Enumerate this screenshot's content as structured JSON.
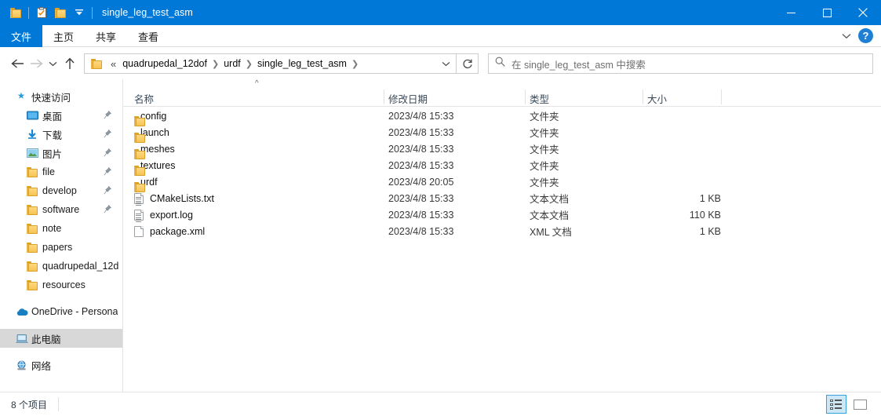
{
  "window": {
    "title": "single_leg_test_asm",
    "accent_color": "#0078d7",
    "quick_access": [
      {
        "name": "folder-icon",
        "label": "保存"
      },
      {
        "name": "properties-icon",
        "label": "属性"
      },
      {
        "name": "new-folder-icon",
        "label": "新建文件夹"
      },
      {
        "name": "customize-qat-icon",
        "label": "自定义快速访问工具栏"
      }
    ],
    "controls": [
      {
        "name": "minimize-button",
        "glyph": "—"
      },
      {
        "name": "maximize-button",
        "glyph": "□"
      },
      {
        "name": "close-button",
        "glyph": "✕"
      }
    ]
  },
  "ribbon": {
    "tabs": [
      {
        "label": "文件",
        "selected": true
      },
      {
        "label": "主页",
        "selected": false
      },
      {
        "label": "共享",
        "selected": false
      },
      {
        "label": "查看",
        "selected": false
      }
    ],
    "expand_label": "展开功能区",
    "help_label": "?"
  },
  "nav": {
    "back_label": "后退",
    "forward_label": "前进",
    "recent_label": "最近浏览的位置",
    "up_label": "上移到",
    "breadcrumb_prefix": "«",
    "breadcrumb": [
      "quadrupedal_12dof",
      "urdf",
      "single_leg_test_asm"
    ],
    "dropdown_label": "先前的位置",
    "refresh_label": "刷新"
  },
  "search": {
    "placeholder": "在 single_leg_test_asm 中搜索",
    "icon": "search-icon"
  },
  "sidebar": {
    "items": [
      {
        "label": "快速访问",
        "icon": "star-pin-icon",
        "level": "root",
        "pinned": false,
        "selected": false
      },
      {
        "label": "桌面",
        "icon": "desktop-icon",
        "level": "child",
        "pinned": true,
        "selected": false
      },
      {
        "label": "下载",
        "icon": "download-icon",
        "level": "child",
        "pinned": true,
        "selected": false
      },
      {
        "label": "图片",
        "icon": "pictures-icon",
        "level": "child",
        "pinned": true,
        "selected": false
      },
      {
        "label": "file",
        "icon": "folder-icon",
        "level": "child",
        "pinned": true,
        "selected": false
      },
      {
        "label": "develop",
        "icon": "folder-icon",
        "level": "child",
        "pinned": true,
        "selected": false
      },
      {
        "label": "software",
        "icon": "folder-icon",
        "level": "child",
        "pinned": true,
        "selected": false
      },
      {
        "label": "note",
        "icon": "folder-icon",
        "level": "child",
        "pinned": false,
        "selected": false
      },
      {
        "label": "papers",
        "icon": "folder-icon",
        "level": "child",
        "pinned": false,
        "selected": false
      },
      {
        "label": "quadrupedal_12d",
        "icon": "folder-icon",
        "level": "child",
        "pinned": false,
        "selected": false
      },
      {
        "label": "resources",
        "icon": "folder-icon",
        "level": "child",
        "pinned": false,
        "selected": false
      },
      {
        "label": "OneDrive - Persona",
        "icon": "onedrive-icon",
        "level": "root",
        "pinned": false,
        "selected": false
      },
      {
        "label": "此电脑",
        "icon": "this-pc-icon",
        "level": "root",
        "pinned": false,
        "selected": true
      },
      {
        "label": "网络",
        "icon": "network-icon",
        "level": "root",
        "pinned": false,
        "selected": false
      }
    ]
  },
  "filelist": {
    "columns": [
      {
        "key": "name",
        "label": "名称",
        "sorted": "asc"
      },
      {
        "key": "date",
        "label": "修改日期",
        "sorted": null
      },
      {
        "key": "type",
        "label": "类型",
        "sorted": null
      },
      {
        "key": "size",
        "label": "大小",
        "sorted": null
      }
    ],
    "rows": [
      {
        "name": "config",
        "date": "2023/4/8 15:33",
        "type": "文件夹",
        "size": "",
        "icon": "folder-icon"
      },
      {
        "name": "launch",
        "date": "2023/4/8 15:33",
        "type": "文件夹",
        "size": "",
        "icon": "folder-icon"
      },
      {
        "name": "meshes",
        "date": "2023/4/8 15:33",
        "type": "文件夹",
        "size": "",
        "icon": "folder-icon"
      },
      {
        "name": "textures",
        "date": "2023/4/8 15:33",
        "type": "文件夹",
        "size": "",
        "icon": "folder-icon"
      },
      {
        "name": "urdf",
        "date": "2023/4/8 20:05",
        "type": "文件夹",
        "size": "",
        "icon": "folder-icon"
      },
      {
        "name": "CMakeLists.txt",
        "date": "2023/4/8 15:33",
        "type": "文本文档",
        "size": "1 KB",
        "icon": "text-file-icon"
      },
      {
        "name": "export.log",
        "date": "2023/4/8 15:33",
        "type": "文本文档",
        "size": "110 KB",
        "icon": "text-file-icon"
      },
      {
        "name": "package.xml",
        "date": "2023/4/8 15:33",
        "type": "XML 文档",
        "size": "1 KB",
        "icon": "xml-file-icon"
      }
    ]
  },
  "status": {
    "item_count": "8 个项目",
    "views": [
      {
        "name": "details-view-button",
        "label": "详细信息",
        "active": true
      },
      {
        "name": "large-icons-view-button",
        "label": "大图标",
        "active": false
      }
    ]
  }
}
